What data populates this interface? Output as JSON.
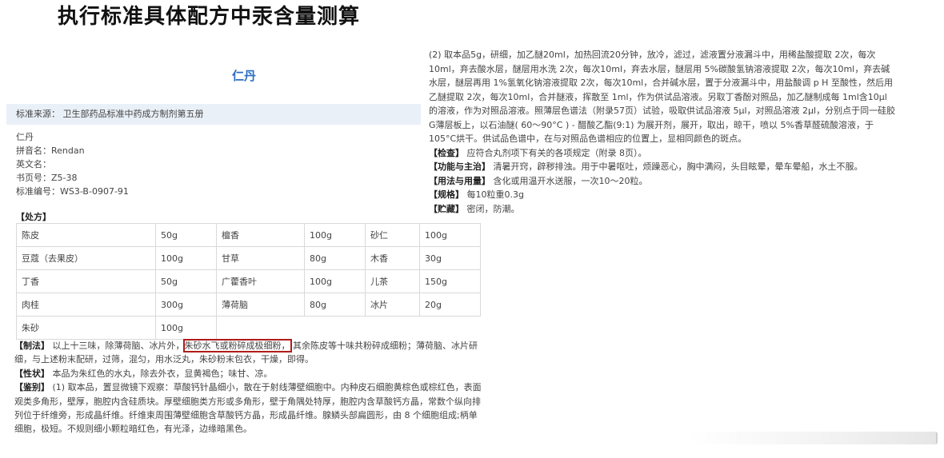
{
  "headline": "执行标准具体配方中汞含量测算",
  "drug_title": "仁丹",
  "source": {
    "label": "标准来源：",
    "value": "卫生部药品标准中药成方制剂第五册"
  },
  "meta": {
    "name": "仁丹",
    "pinyin": "拼音名：Rendan",
    "english": "英文名：",
    "book_page": "书页号：Z5-38",
    "standard_no": "标准编号：WS3-B-0907-91"
  },
  "recipe": {
    "label": "【处方】",
    "rows": [
      [
        {
          "name": "陈皮",
          "amount": "50g"
        },
        {
          "name": "檀香",
          "amount": "100g"
        },
        {
          "name": "砂仁",
          "amount": "100g"
        }
      ],
      [
        {
          "name": "豆蔻（去果皮）",
          "amount": "100g"
        },
        {
          "name": "甘草",
          "amount": "80g"
        },
        {
          "name": "木香",
          "amount": "30g"
        }
      ],
      [
        {
          "name": "丁香",
          "amount": "50g"
        },
        {
          "name": "广藿香叶",
          "amount": "100g"
        },
        {
          "name": "儿茶",
          "amount": "150g"
        }
      ],
      [
        {
          "name": "肉桂",
          "amount": "300g"
        },
        {
          "name": "薄荷脑",
          "amount": "80g"
        },
        {
          "name": "冰片",
          "amount": "20g"
        }
      ],
      [
        {
          "name": "朱砂",
          "amount": "100g"
        }
      ]
    ]
  },
  "method": {
    "label": "【制法】",
    "before": "以上十三味，除薄荷脑、冰片外，",
    "highlight": "朱砂水飞或粉碎成极细粉，",
    "after": "其余陈皮等十味共粉碎成细粉；薄荷脑、冰片研细，与上述粉末配研，过筛，混匀，用水泛丸，朱砂粉末包衣，干燥，即得。"
  },
  "character": {
    "label": "【性状】",
    "text": "本品为朱红色的水丸，除去外衣，显黄褐色；味甘、凉。"
  },
  "identification": {
    "label": "【鉴别】",
    "text": "(1) 取本品，置显微镜下观察：草酸钙针晶细小，散在于射线薄壁细胞中。内种皮石细胞黄棕色或棕红色，表面观类多角形，壁厚，胞腔内含硅质块。厚壁细胞类方形或多角形，壁于角隅处特厚，胞腔内含草酸钙方晶，常数个纵向排列位于纤维旁，形成晶纤维。纤维束周围薄壁细胞含草酸钙方晶，形成晶纤维。腺鳞头部扁圆形，由 8 个细胞组成;柄单细胞，极短。不规则细小颗粒暗红色，有光泽，边缘暗黑色。"
  },
  "right": {
    "identification2": "(2) 取本品5g，研细，加乙醚20ml，加热回流20分钟，放冷，滤过，滤液置分液漏斗中，用稀盐酸提取 2次，每次10ml，弃去酸水层，醚层用水洗 2次，每次10ml，弃去水层，醚层用 5%碳酸氢钠溶液提取 2次，每次10ml，弃去碱水层，醚层再用 1%氢氧化钠溶液提取 2次，每次10ml，合并碱水层，置于分液漏斗中，用盐酸调 p H 至酸性，然后用乙醚提取 2次，每次10ml，合并醚液，挥散至 1ml，作为供试品溶液。另取丁香酚对照品，加乙醚制成每 1ml含10μl 的溶液，作为对照品溶液。照薄层色谱法（附录57页）试验，吸取供试品溶液 5μl，对照品溶液 2μl，分别点于同一硅胶G薄层板上，以石油醚( 60～90°C ) - 醋酸乙酯(9:1) 为展开剂，展开，取出，晾干，喷以 5%香草醛硫酸溶液，于 105°C烘干。供试品色谱中，在与对照品色谱相应的位置上，显相同颜色的斑点。",
    "inspection_label": "【检查】",
    "inspection_text": "应符合丸剂项下有关的各项规定（附录 8页）。",
    "function_label": "【功能与主治】",
    "function_text": "清暑开窍，辟秽排浊。用于中暑呕吐，烦躁恶心，胸中满闷，头目眩晕，晕车晕船，水土不服。",
    "usage_label": "【用法与用量】",
    "usage_text": "含化或用温开水送服，一次10～20粒。",
    "spec_label": "【规格】",
    "spec_text": "每10粒重0.3g",
    "storage_label": "【贮藏】",
    "storage_text": "密闭，防潮。"
  },
  "colors": {
    "title_blue": "#2a6fc4",
    "source_bar_bg": "#eaf0f8",
    "highlight_border": "#b01c1c"
  }
}
